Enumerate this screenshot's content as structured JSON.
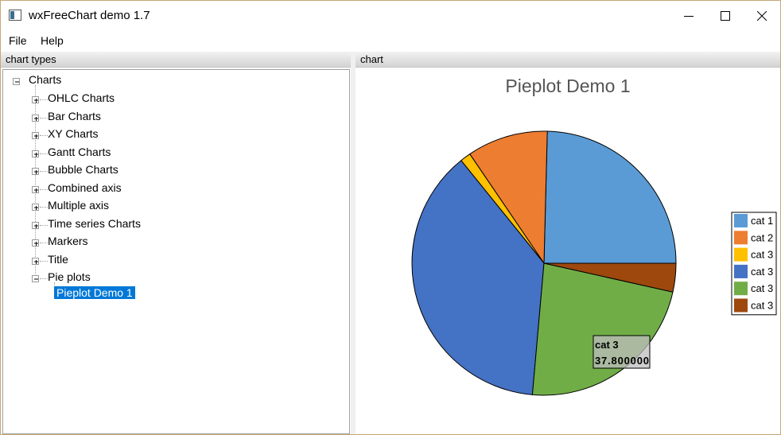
{
  "window": {
    "title": "wxFreeChart demo 1.7"
  },
  "menu": [
    "File",
    "Help"
  ],
  "left_panel": {
    "header": "chart types",
    "root": "Charts",
    "items": [
      {
        "label": "OHLC Charts",
        "expanded": false
      },
      {
        "label": "Bar Charts",
        "expanded": false
      },
      {
        "label": "XY Charts",
        "expanded": false
      },
      {
        "label": "Gantt Charts",
        "expanded": false
      },
      {
        "label": "Bubble Charts",
        "expanded": false
      },
      {
        "label": "Combined axis",
        "expanded": false
      },
      {
        "label": "Multiple axis",
        "expanded": false
      },
      {
        "label": "Time series Charts",
        "expanded": false
      },
      {
        "label": "Markers",
        "expanded": false
      },
      {
        "label": "Title",
        "expanded": false
      },
      {
        "label": "Pie plots",
        "expanded": true
      }
    ],
    "selected_child": "Pieplot Demo 1"
  },
  "right_panel": {
    "header": "chart"
  },
  "colors": {
    "accent": "#0078d7",
    "titlebar_border": "#c9a77a"
  },
  "chart_data": {
    "type": "pie",
    "title": "Pieplot Demo 1",
    "slices": [
      {
        "label": "cat 1",
        "value": 24.6,
        "color": "#5b9bd5"
      },
      {
        "label": "cat 2",
        "value": 9.9,
        "color": "#ed7d31"
      },
      {
        "label": "cat 3",
        "value": 1.3,
        "color": "#ffc000"
      },
      {
        "label": "cat 3",
        "value": 37.8,
        "color": "#4472c4"
      },
      {
        "label": "cat 3",
        "value": 22.9,
        "color": "#70ad47"
      },
      {
        "label": "cat 3",
        "value": 3.5,
        "color": "#9e480e"
      }
    ],
    "legend_placement": "right",
    "tooltip": {
      "label": "cat 3",
      "value": "37.800000"
    }
  }
}
